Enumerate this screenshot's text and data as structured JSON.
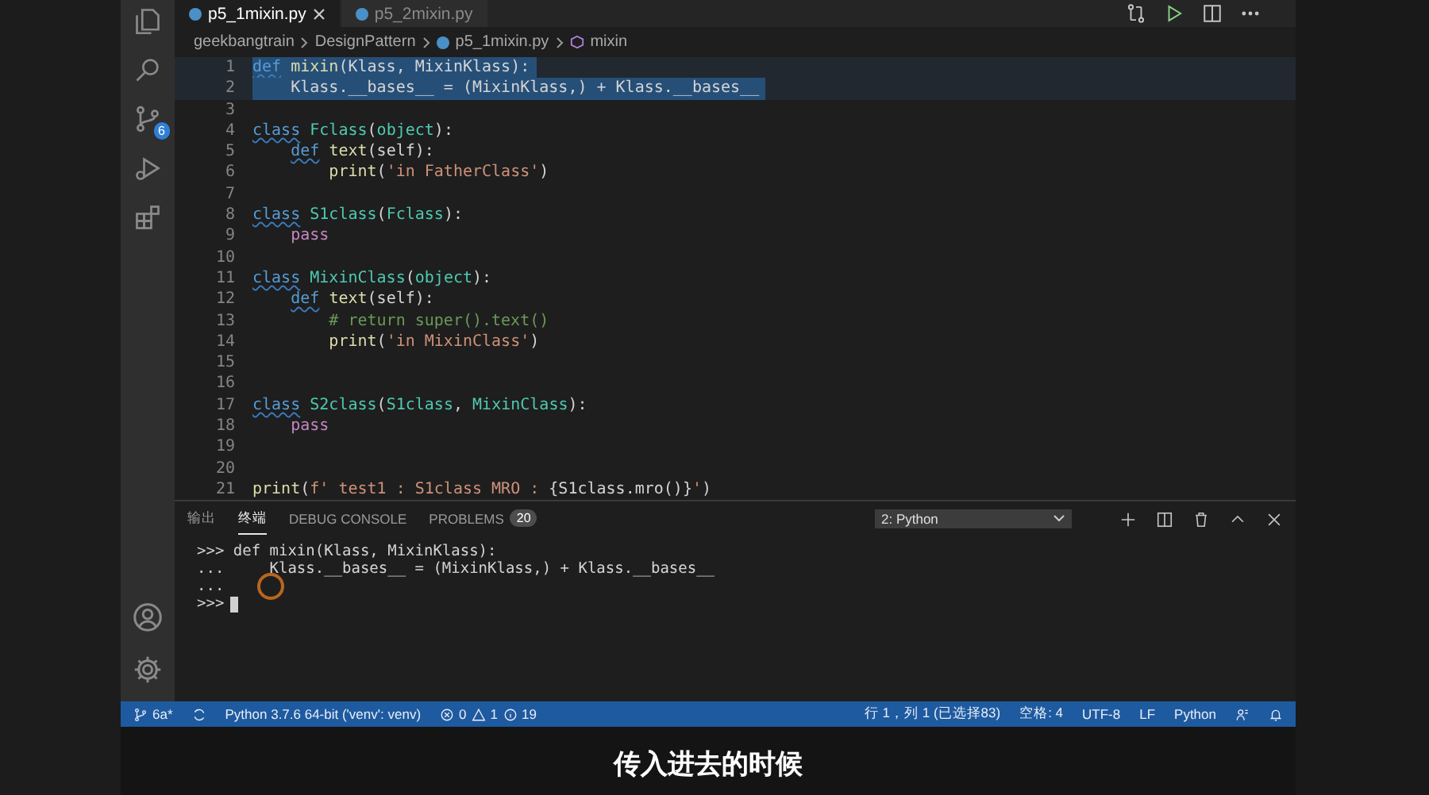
{
  "activity_bar": {
    "source_control_badge": "6"
  },
  "editor_tabs": [
    {
      "label": "p5_1mixin.py",
      "selected": true
    },
    {
      "label": "p5_2mixin.py",
      "selected": false
    }
  ],
  "breadcrumbs": [
    "geekbangtrain",
    "DesignPattern",
    "p5_1mixin.py",
    "mixin"
  ],
  "code": [
    {
      "n": "1",
      "selected": true,
      "tokens": [
        {
          "kind": "kw",
          "text": "def"
        },
        {
          "kind": "fn",
          "text": " mixin"
        },
        {
          "kind": "p",
          "text": "(Klass, MixinKlass):"
        }
      ]
    },
    {
      "n": "2",
      "selected": true,
      "tokens": [
        {
          "kind": "p",
          "text": "    Klass.__bases__ = (MixinKlass,) + Klass.__bases__"
        }
      ]
    },
    {
      "n": "3",
      "selected": false
    },
    {
      "n": "4",
      "selected": false,
      "tokens": [
        {
          "kind": "kw",
          "text": "class"
        },
        {
          "kind": "cls",
          "text": " Fclass"
        },
        {
          "kind": "p",
          "text": "("
        },
        {
          "kind": "cls",
          "text": "object"
        },
        {
          "kind": "p",
          "text": "):"
        }
      ]
    },
    {
      "n": "5",
      "selected": false,
      "tokens": [
        {
          "kind": "kw",
          "text": "    def"
        },
        {
          "kind": "fn",
          "text": " text"
        },
        {
          "kind": "p",
          "text": "(self):"
        }
      ]
    },
    {
      "n": "6",
      "selected": false,
      "tokens": [
        {
          "kind": "fn",
          "text": "        print"
        },
        {
          "kind": "p",
          "text": "("
        },
        {
          "kind": "str",
          "text": "'in FatherClass'"
        },
        {
          "kind": "p",
          "text": ")"
        }
      ]
    },
    {
      "n": "7",
      "selected": false
    },
    {
      "n": "8",
      "selected": false,
      "tokens": [
        {
          "kind": "kw",
          "text": "class"
        },
        {
          "kind": "cls",
          "text": " S1class"
        },
        {
          "kind": "p",
          "text": "("
        },
        {
          "kind": "cls",
          "text": "Fclass"
        },
        {
          "kind": "p",
          "text": "):"
        }
      ]
    },
    {
      "n": "9",
      "selected": false,
      "tokens": [
        {
          "kind": "ctl",
          "text": "    pass"
        }
      ]
    },
    {
      "n": "10",
      "selected": false
    },
    {
      "n": "11",
      "selected": false,
      "tokens": [
        {
          "kind": "kw",
          "text": "class"
        },
        {
          "kind": "cls",
          "text": " MixinClass"
        },
        {
          "kind": "p",
          "text": "("
        },
        {
          "kind": "cls",
          "text": "object"
        },
        {
          "kind": "p",
          "text": "):"
        }
      ]
    },
    {
      "n": "12",
      "selected": false,
      "tokens": [
        {
          "kind": "kw",
          "text": "    def"
        },
        {
          "kind": "fn",
          "text": " text"
        },
        {
          "kind": "p",
          "text": "(self):"
        }
      ]
    },
    {
      "n": "13",
      "selected": false,
      "tokens": [
        {
          "kind": "cmt",
          "text": "        # return super().text()"
        }
      ]
    },
    {
      "n": "14",
      "selected": false,
      "tokens": [
        {
          "kind": "fn",
          "text": "        print"
        },
        {
          "kind": "p",
          "text": "("
        },
        {
          "kind": "str",
          "text": "'in MixinClass'"
        },
        {
          "kind": "p",
          "text": ")"
        }
      ]
    },
    {
      "n": "15",
      "selected": false
    },
    {
      "n": "16",
      "selected": false
    },
    {
      "n": "17",
      "selected": false,
      "tokens": [
        {
          "kind": "kw",
          "text": "class"
        },
        {
          "kind": "cls",
          "text": " S2class"
        },
        {
          "kind": "p",
          "text": "("
        },
        {
          "kind": "cls",
          "text": "S1class"
        },
        {
          "kind": "p",
          "text": ", "
        },
        {
          "kind": "cls",
          "text": "MixinClass"
        },
        {
          "kind": "p",
          "text": "):"
        }
      ]
    },
    {
      "n": "18",
      "selected": false,
      "tokens": [
        {
          "kind": "ctl",
          "text": "    pass"
        }
      ]
    },
    {
      "n": "19",
      "selected": false
    },
    {
      "n": "20",
      "selected": false
    },
    {
      "n": "21",
      "selected": false,
      "tokens": [
        {
          "kind": "fn",
          "text": "print"
        },
        {
          "kind": "p",
          "text": "("
        },
        {
          "kind": "str",
          "text": "f' test1 : S1class MRO : "
        },
        {
          "kind": "p",
          "text": "{S1class.mro()}"
        },
        {
          "kind": "str",
          "text": "'"
        },
        {
          "kind": "p",
          "text": ")"
        }
      ]
    }
  ],
  "panel": {
    "tabs": [
      {
        "label": "输出",
        "selected": false
      },
      {
        "label": "终端",
        "selected": true
      },
      {
        "label": "DEBUG CONSOLE",
        "selected": false
      },
      {
        "label": "PROBLEMS",
        "selected": false,
        "badge": "20"
      }
    ],
    "terminal_select": "2: Python",
    "terminal_lines": [
      ">>> def mixin(Klass, MixinKlass):",
      "...     Klass.__bases__ = (MixinKlass,) + Klass.__bases__",
      "...",
      ">>>"
    ]
  },
  "status_bar": {
    "branch": "6a*",
    "interpreter": "Python 3.7.6 64-bit ('venv': venv)",
    "errors": "0",
    "warnings": "1",
    "infos": "19",
    "right": [
      "行 1，列 1 (已选择83)",
      "空格: 4",
      "UTF-8",
      "LF",
      "Python"
    ]
  },
  "subtitle": "传入进去的时候"
}
